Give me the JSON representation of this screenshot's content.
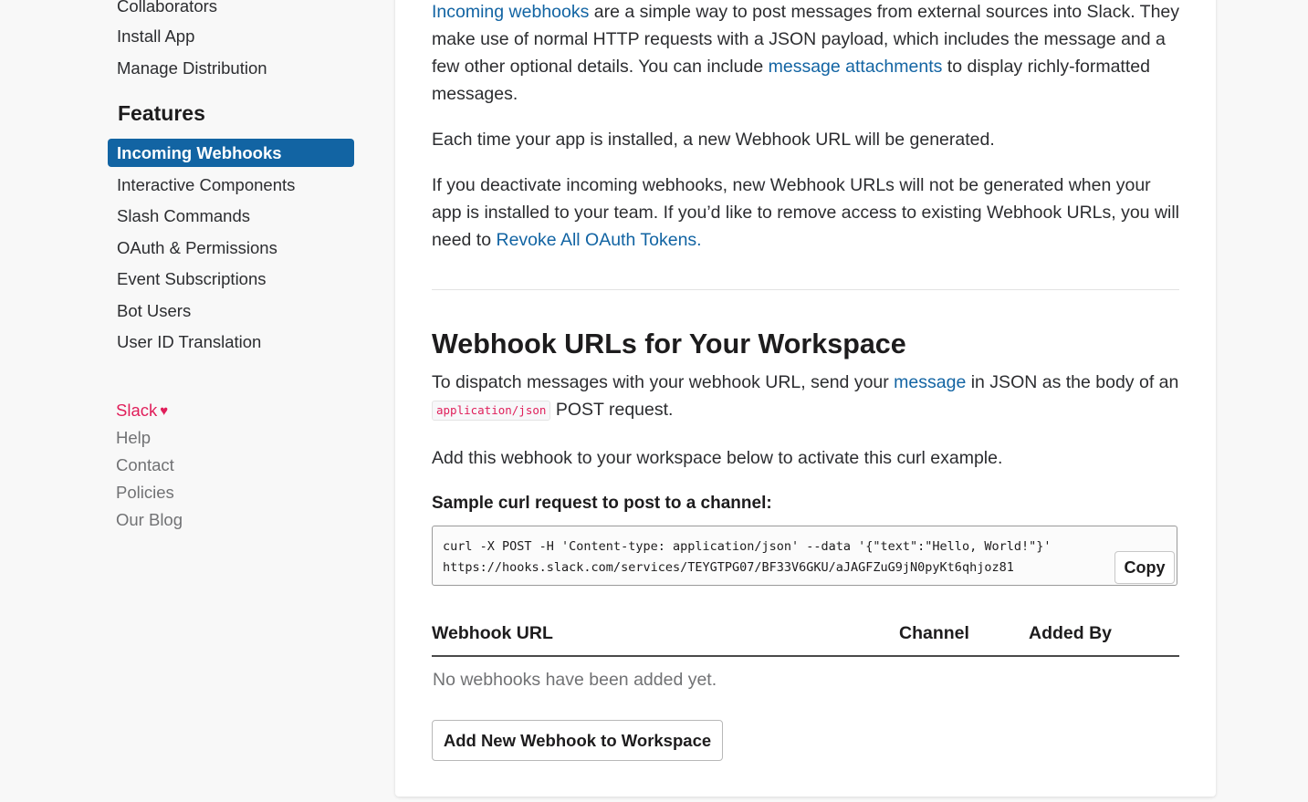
{
  "sidebar": {
    "top_items": [
      {
        "label": "Collaborators"
      },
      {
        "label": "Install App"
      },
      {
        "label": "Manage Distribution"
      }
    ],
    "features_heading": "Features",
    "active_item": "Incoming Webhooks",
    "feature_items": [
      {
        "label": "Interactive Components"
      },
      {
        "label": "Slash Commands"
      },
      {
        "label": "OAuth & Permissions"
      },
      {
        "label": "Event Subscriptions"
      },
      {
        "label": "Bot Users"
      },
      {
        "label": "User ID Translation"
      }
    ],
    "footer": {
      "slack": "Slack",
      "heart": "♥",
      "help": "Help",
      "contact": "Contact",
      "policies": "Policies",
      "blog": "Our Blog"
    }
  },
  "main": {
    "intro": {
      "link1": "Incoming webhooks",
      "text1": " are a simple way to post messages from external sources into Slack. They make use of normal HTTP requests with a JSON payload, which includes the message and a few other optional details. You can include ",
      "link2": "message attachments",
      "text2": " to display richly-formatted messages."
    },
    "para_install": "Each time your app is installed, a new Webhook URL will be generated.",
    "deactivate": {
      "text": "If you deactivate incoming webhooks, new Webhook URLs will not be generated when your app is installed to your team. If you’d like to remove access to existing Webhook URLs, you will need to ",
      "link": "Revoke All OAuth Tokens."
    },
    "section_title": "Webhook URLs for Your Workspace",
    "dispatch": {
      "text1": "To dispatch messages with your webhook URL, send your ",
      "link": "message",
      "text2": " in JSON as the body of an ",
      "code": "application/json",
      "text3": " POST request."
    },
    "add_text": "Add this webhook to your workspace below to activate this curl example.",
    "sample_heading": "Sample curl request to post to a channel:",
    "code_lines": [
      "curl -X POST -H 'Content-type: application/json' --data '{\"text\":\"Hello, World!\"}'",
      "https://hooks.slack.com/services/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"
    ],
    "copy_label": "Copy",
    "table": {
      "headers": [
        "Webhook URL",
        "Channel",
        "Added By"
      ],
      "empty": "No webhooks have been added yet."
    },
    "add_button": "Add New Webhook to Workspace"
  },
  "colors": {
    "accent": "#1264a3",
    "slack_red": "#e01e5a"
  }
}
